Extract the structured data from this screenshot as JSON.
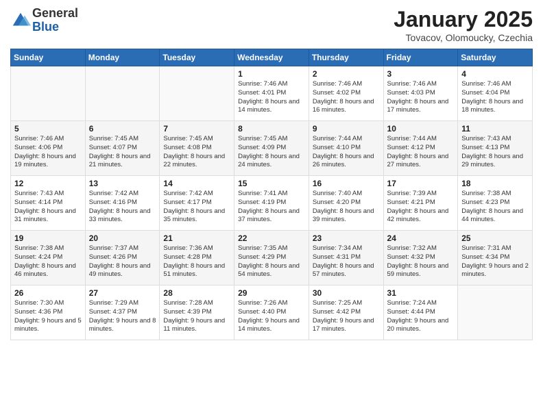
{
  "logo": {
    "general": "General",
    "blue": "Blue"
  },
  "title": "January 2025",
  "subtitle": "Tovacov, Olomoucky, Czechia",
  "days_of_week": [
    "Sunday",
    "Monday",
    "Tuesday",
    "Wednesday",
    "Thursday",
    "Friday",
    "Saturday"
  ],
  "weeks": [
    {
      "cells": [
        {
          "day": "",
          "info": ""
        },
        {
          "day": "",
          "info": ""
        },
        {
          "day": "",
          "info": ""
        },
        {
          "day": "1",
          "info": "Sunrise: 7:46 AM\nSunset: 4:01 PM\nDaylight: 8 hours and 14 minutes."
        },
        {
          "day": "2",
          "info": "Sunrise: 7:46 AM\nSunset: 4:02 PM\nDaylight: 8 hours and 16 minutes."
        },
        {
          "day": "3",
          "info": "Sunrise: 7:46 AM\nSunset: 4:03 PM\nDaylight: 8 hours and 17 minutes."
        },
        {
          "day": "4",
          "info": "Sunrise: 7:46 AM\nSunset: 4:04 PM\nDaylight: 8 hours and 18 minutes."
        }
      ]
    },
    {
      "cells": [
        {
          "day": "5",
          "info": "Sunrise: 7:46 AM\nSunset: 4:06 PM\nDaylight: 8 hours and 19 minutes."
        },
        {
          "day": "6",
          "info": "Sunrise: 7:45 AM\nSunset: 4:07 PM\nDaylight: 8 hours and 21 minutes."
        },
        {
          "day": "7",
          "info": "Sunrise: 7:45 AM\nSunset: 4:08 PM\nDaylight: 8 hours and 22 minutes."
        },
        {
          "day": "8",
          "info": "Sunrise: 7:45 AM\nSunset: 4:09 PM\nDaylight: 8 hours and 24 minutes."
        },
        {
          "day": "9",
          "info": "Sunrise: 7:44 AM\nSunset: 4:10 PM\nDaylight: 8 hours and 26 minutes."
        },
        {
          "day": "10",
          "info": "Sunrise: 7:44 AM\nSunset: 4:12 PM\nDaylight: 8 hours and 27 minutes."
        },
        {
          "day": "11",
          "info": "Sunrise: 7:43 AM\nSunset: 4:13 PM\nDaylight: 8 hours and 29 minutes."
        }
      ]
    },
    {
      "cells": [
        {
          "day": "12",
          "info": "Sunrise: 7:43 AM\nSunset: 4:14 PM\nDaylight: 8 hours and 31 minutes."
        },
        {
          "day": "13",
          "info": "Sunrise: 7:42 AM\nSunset: 4:16 PM\nDaylight: 8 hours and 33 minutes."
        },
        {
          "day": "14",
          "info": "Sunrise: 7:42 AM\nSunset: 4:17 PM\nDaylight: 8 hours and 35 minutes."
        },
        {
          "day": "15",
          "info": "Sunrise: 7:41 AM\nSunset: 4:19 PM\nDaylight: 8 hours and 37 minutes."
        },
        {
          "day": "16",
          "info": "Sunrise: 7:40 AM\nSunset: 4:20 PM\nDaylight: 8 hours and 39 minutes."
        },
        {
          "day": "17",
          "info": "Sunrise: 7:39 AM\nSunset: 4:21 PM\nDaylight: 8 hours and 42 minutes."
        },
        {
          "day": "18",
          "info": "Sunrise: 7:38 AM\nSunset: 4:23 PM\nDaylight: 8 hours and 44 minutes."
        }
      ]
    },
    {
      "cells": [
        {
          "day": "19",
          "info": "Sunrise: 7:38 AM\nSunset: 4:24 PM\nDaylight: 8 hours and 46 minutes."
        },
        {
          "day": "20",
          "info": "Sunrise: 7:37 AM\nSunset: 4:26 PM\nDaylight: 8 hours and 49 minutes."
        },
        {
          "day": "21",
          "info": "Sunrise: 7:36 AM\nSunset: 4:28 PM\nDaylight: 8 hours and 51 minutes."
        },
        {
          "day": "22",
          "info": "Sunrise: 7:35 AM\nSunset: 4:29 PM\nDaylight: 8 hours and 54 minutes."
        },
        {
          "day": "23",
          "info": "Sunrise: 7:34 AM\nSunset: 4:31 PM\nDaylight: 8 hours and 57 minutes."
        },
        {
          "day": "24",
          "info": "Sunrise: 7:32 AM\nSunset: 4:32 PM\nDaylight: 8 hours and 59 minutes."
        },
        {
          "day": "25",
          "info": "Sunrise: 7:31 AM\nSunset: 4:34 PM\nDaylight: 9 hours and 2 minutes."
        }
      ]
    },
    {
      "cells": [
        {
          "day": "26",
          "info": "Sunrise: 7:30 AM\nSunset: 4:36 PM\nDaylight: 9 hours and 5 minutes."
        },
        {
          "day": "27",
          "info": "Sunrise: 7:29 AM\nSunset: 4:37 PM\nDaylight: 9 hours and 8 minutes."
        },
        {
          "day": "28",
          "info": "Sunrise: 7:28 AM\nSunset: 4:39 PM\nDaylight: 9 hours and 11 minutes."
        },
        {
          "day": "29",
          "info": "Sunrise: 7:26 AM\nSunset: 4:40 PM\nDaylight: 9 hours and 14 minutes."
        },
        {
          "day": "30",
          "info": "Sunrise: 7:25 AM\nSunset: 4:42 PM\nDaylight: 9 hours and 17 minutes."
        },
        {
          "day": "31",
          "info": "Sunrise: 7:24 AM\nSunset: 4:44 PM\nDaylight: 9 hours and 20 minutes."
        },
        {
          "day": "",
          "info": ""
        }
      ]
    }
  ]
}
